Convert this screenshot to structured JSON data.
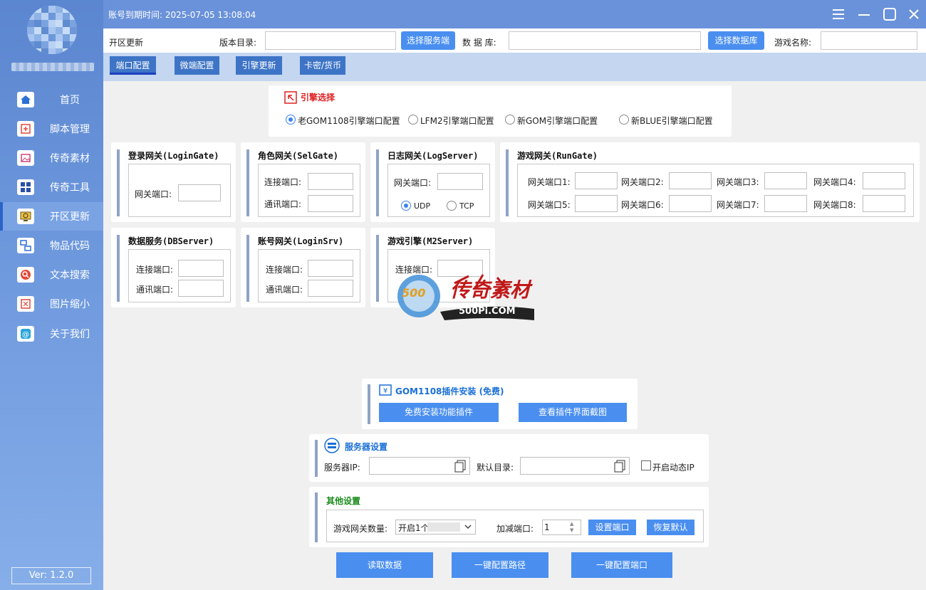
{
  "sidebar": {
    "items": [
      {
        "label": "首页",
        "icon": "home-icon"
      },
      {
        "label": "脚本管理",
        "icon": "script-icon"
      },
      {
        "label": "传奇素材",
        "icon": "image-icon"
      },
      {
        "label": "传奇工具",
        "icon": "grid-icon"
      },
      {
        "label": "开区更新",
        "icon": "monitor-refresh-icon"
      },
      {
        "label": "物品代码",
        "icon": "code-icon"
      },
      {
        "label": "文本搜索",
        "icon": "search-icon"
      },
      {
        "label": "图片缩小",
        "icon": "shrink-icon"
      },
      {
        "label": "关于我们",
        "icon": "about-icon"
      }
    ],
    "active_index": 4,
    "version": "Ver: 1.2.0"
  },
  "titlebar": {
    "expire_text": "账号到期时间: 2025-07-05 13:08:04"
  },
  "toolbar": {
    "section_label": "开区更新",
    "version_dir_label": "版本目录:",
    "version_dir_value": "",
    "select_server_btn": "选择服务端",
    "database_label": "数 据 库:",
    "database_value": "",
    "select_db_btn": "选择数据库",
    "game_name_label": "游戏名称:",
    "game_name_value": ""
  },
  "tabs": [
    "端口配置",
    "微端配置",
    "引擎更新",
    "卡密/货币"
  ],
  "engine_select": {
    "title": "引擎选择",
    "options": [
      "老GOM1108引擎端口配置",
      "LFM2引擎端口配置",
      "新GOM引擎端口配置",
      "新BLUE引擎端口配置"
    ],
    "selected": 0
  },
  "login_gate": {
    "title": "登录网关(LoginGate)",
    "port_label": "网关端口:"
  },
  "sel_gate": {
    "title": "角色网关(SelGate)",
    "conn_label": "连接端口:",
    "comm_label": "通讯端口:"
  },
  "log_server": {
    "title": "日志网关(LogServer)",
    "port_label": "网关端口:",
    "udp": "UDP",
    "tcp": "TCP"
  },
  "run_gate": {
    "title": "游戏网关(RunGate)",
    "ports": [
      "网关端口1:",
      "网关端口2:",
      "网关端口3:",
      "网关端口4:",
      "网关端口5:",
      "网关端口6:",
      "网关端口7:",
      "网关端口8:"
    ]
  },
  "db_server": {
    "title": "数据服务(DBServer)",
    "conn_label": "连接端口:",
    "comm_label": "通讯端口:"
  },
  "login_srv": {
    "title": "账号网关(LoginSrv)",
    "conn_label": "连接端口:",
    "comm_label": "通讯端口:"
  },
  "m2_server": {
    "title": "游戏引擎(M2Server)",
    "conn_label": "连接端口:"
  },
  "watermark": {
    "text1": "传奇素材",
    "text2": "500Pi.COM",
    "text3": "500"
  },
  "plugin": {
    "title": "GOM1108插件安装 (免费)",
    "install_btn": "免费安装功能插件",
    "view_btn": "查看插件界面截图"
  },
  "server_settings": {
    "title": "服务器设置",
    "ip_label": "服务器IP:",
    "dir_label": "默认目录:",
    "dynamic_ip_label": "开启动态IP",
    "dynamic_ip_checked": false
  },
  "other_settings": {
    "title": "其他设置",
    "gate_count_label": "游戏网关数量:",
    "gate_count_value": "开启1个",
    "add_port_label": "加减端口:",
    "add_port_value": "1",
    "set_port_btn": "设置端口",
    "restore_btn": "恢复默认"
  },
  "bottom_buttons": [
    "读取数据",
    "一键配置路径",
    "一键配置端口"
  ],
  "colors": {
    "sidebar": "#6a92da",
    "accent": "#4a8ff0",
    "tab": "#3d74c6",
    "engine_title": "#e02020",
    "other_title": "#1a8a1a"
  }
}
